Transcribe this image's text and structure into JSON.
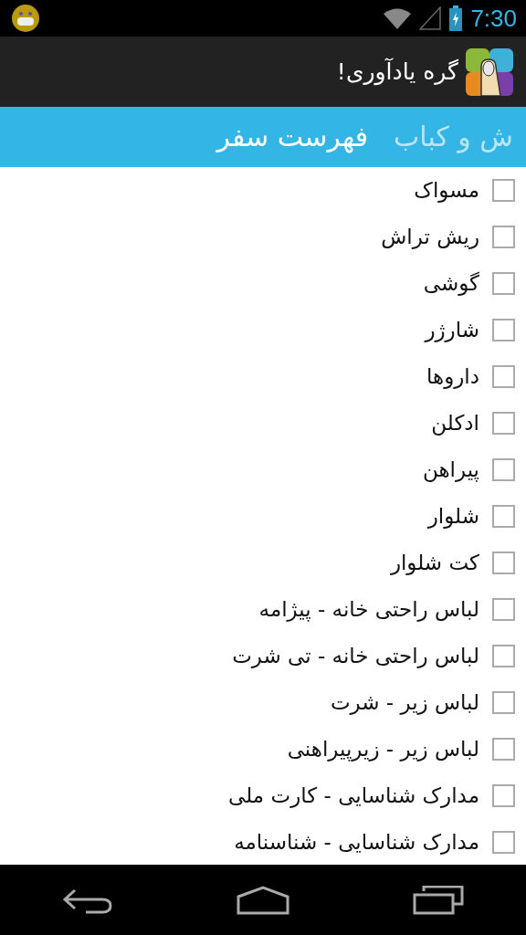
{
  "status_bar": {
    "time": "7:30"
  },
  "action_bar": {
    "title": "گره یادآوری!"
  },
  "tabs": [
    {
      "label": "ش و کباب",
      "selected": false
    },
    {
      "label": "فهرست سفر",
      "selected": true
    }
  ],
  "items": [
    {
      "label": "مسواک",
      "checked": false
    },
    {
      "label": "ریش تراش",
      "checked": false
    },
    {
      "label": "گوشی",
      "checked": false
    },
    {
      "label": "شارژر",
      "checked": false
    },
    {
      "label": "داروها",
      "checked": false
    },
    {
      "label": "ادکلن",
      "checked": false
    },
    {
      "label": "پیراهن",
      "checked": false
    },
    {
      "label": "شلوار",
      "checked": false
    },
    {
      "label": "کت شلوار",
      "checked": false
    },
    {
      "label": "لباس راحتی خانه - پیژامه",
      "checked": false
    },
    {
      "label": "لباس راحتی خانه - تی شرت",
      "checked": false
    },
    {
      "label": "لباس زیر - شرت",
      "checked": false
    },
    {
      "label": "لباس زیر - زیرپیراهنی",
      "checked": false
    },
    {
      "label": "مدارک شناسایی - کارت ملی",
      "checked": false
    },
    {
      "label": "مدارک شناسایی - شناسنامه",
      "checked": false
    }
  ]
}
